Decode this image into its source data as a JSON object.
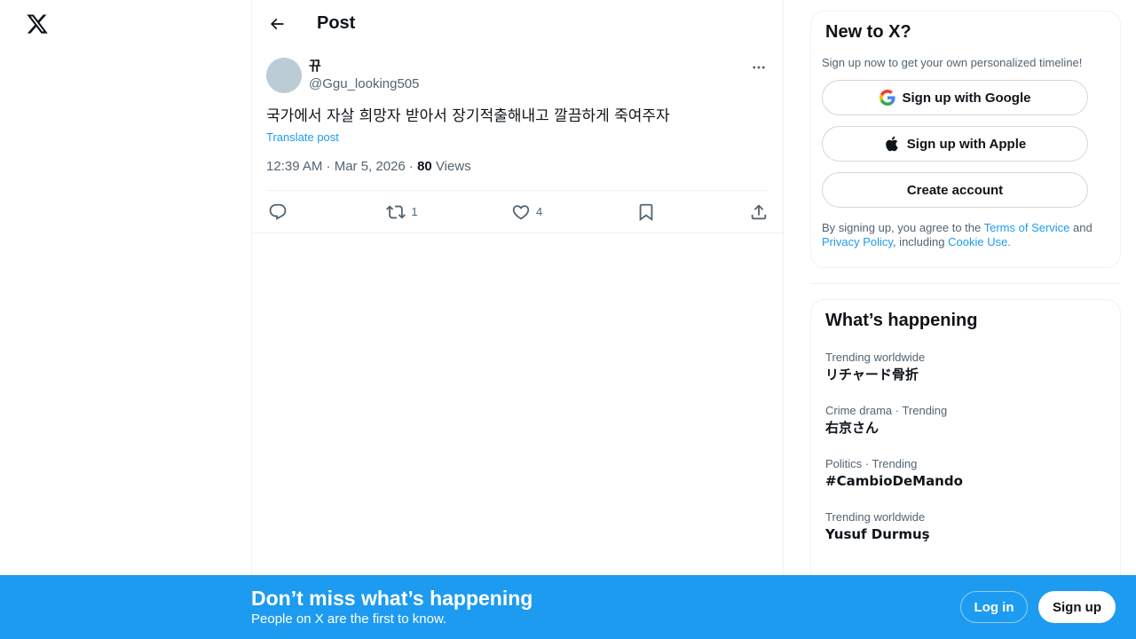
{
  "nav": {
    "logo_icon": "x-logo-icon"
  },
  "header": {
    "title": "Post",
    "back_icon": "arrow-left-icon"
  },
  "tweet": {
    "display_name": "뀨",
    "handle": "@Ggu_looking505",
    "text": "국가에서 자살 희망자 받아서 장기적출해내고 깔끔하게 죽여주자",
    "translate_label": "Translate post",
    "time": "12:39 AM · Mar 5, 2026 · ",
    "views_count": "80",
    "views_label": " Views",
    "actions": {
      "reply_count": "",
      "retweet_count": "1",
      "like_count": "4"
    }
  },
  "signup": {
    "title": "New to X?",
    "subtitle": "Sign up now to get your own personalized timeline!",
    "google_label": "Sign up with Google",
    "apple_label": "Sign up with Apple",
    "create_label": "Create account",
    "legal_prefix": "By signing up, you agree to the ",
    "terms_label": "Terms of Service",
    "and_text": " and ",
    "privacy_label": "Privacy Policy",
    "including_text": ", including ",
    "cookie_label": "Cookie Use."
  },
  "trends": {
    "title": "What’s happening",
    "items": [
      {
        "meta": "Trending worldwide",
        "name": "リチャード骨折"
      },
      {
        "meta": "Crime drama · Trending",
        "name": "右京さん"
      },
      {
        "meta": "Politics · Trending",
        "name": "#CambioDeMando"
      },
      {
        "meta": "Trending worldwide",
        "name": "Yusuf Durmuş"
      }
    ]
  },
  "banner": {
    "title": "Don’t miss what’s happening",
    "subtitle": "People on X are the first to know.",
    "login_label": "Log in",
    "signup_label": "Sign up"
  },
  "colors": {
    "accent": "#1d9bf0",
    "text": "#0f1419",
    "muted": "#536471"
  }
}
